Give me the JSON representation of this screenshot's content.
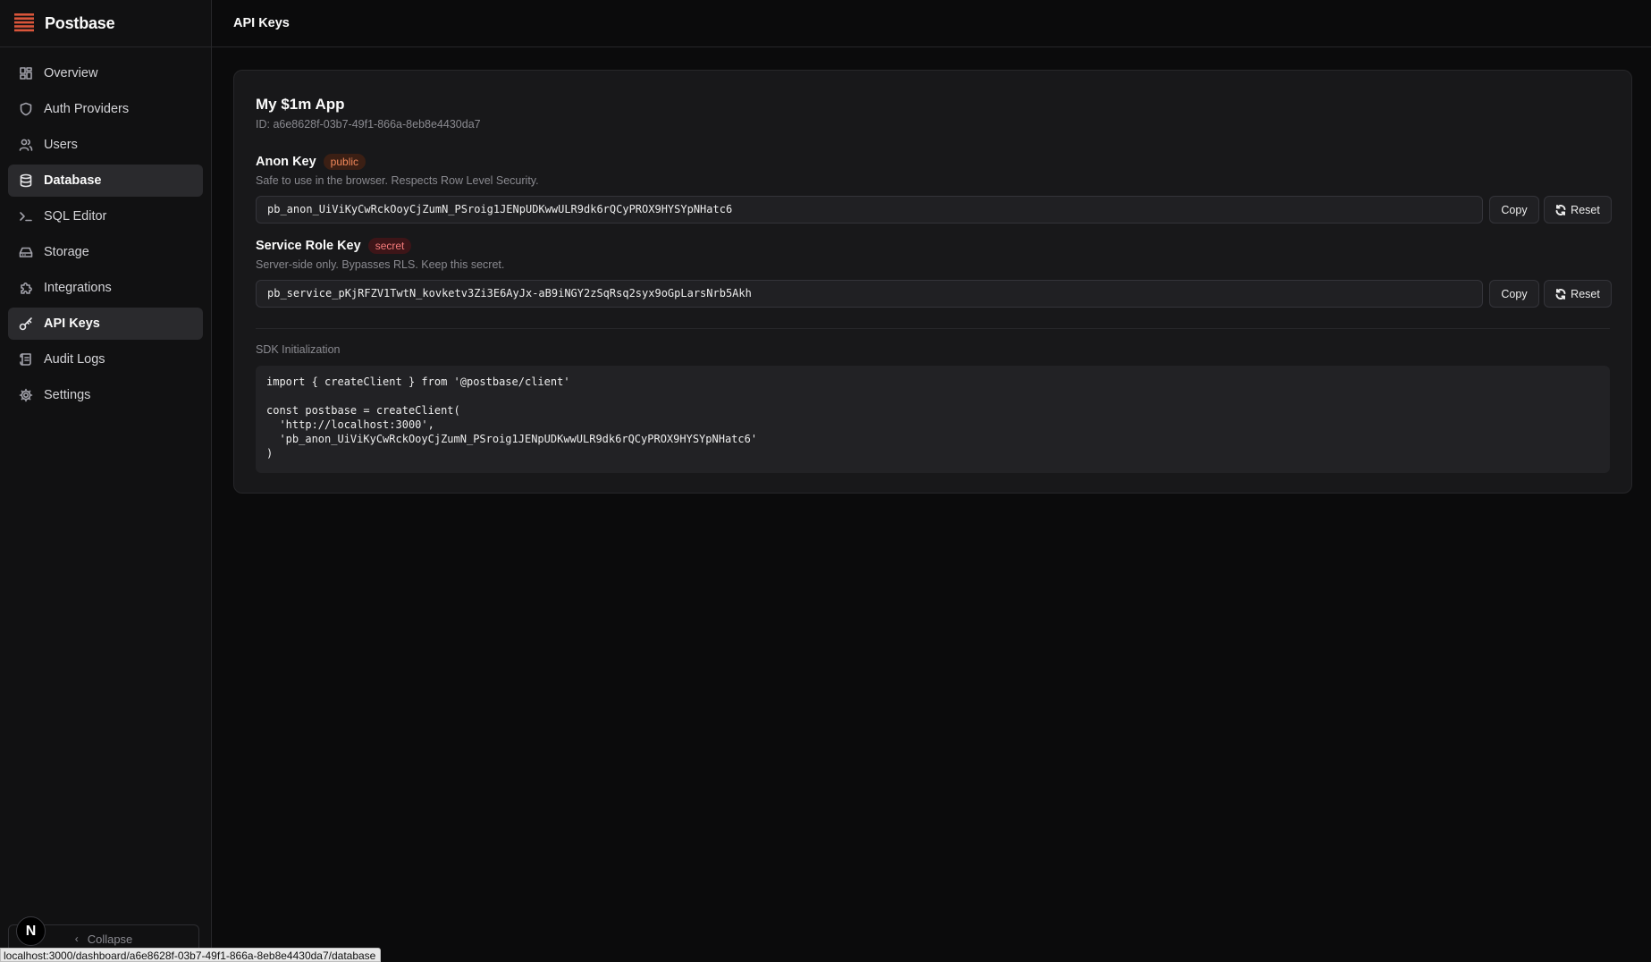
{
  "brand": {
    "name": "Postbase",
    "accent": "#d9553a"
  },
  "sidebar": {
    "items": [
      {
        "label": "Overview",
        "icon": "grid-icon"
      },
      {
        "label": "Auth Providers",
        "icon": "shield-icon"
      },
      {
        "label": "Users",
        "icon": "users-icon"
      },
      {
        "label": "Database",
        "icon": "database-icon",
        "active": true
      },
      {
        "label": "SQL Editor",
        "icon": "terminal-icon"
      },
      {
        "label": "Storage",
        "icon": "hard-drive-icon"
      },
      {
        "label": "Integrations",
        "icon": "puzzle-icon"
      },
      {
        "label": "API Keys",
        "icon": "key-icon",
        "active": true
      },
      {
        "label": "Audit Logs",
        "icon": "scroll-icon"
      },
      {
        "label": "Settings",
        "icon": "gear-icon"
      }
    ],
    "collapse_label": "Collapse",
    "n_badge": "N"
  },
  "header": {
    "title": "API Keys"
  },
  "project": {
    "name": "My $1m App",
    "id_text": "ID: a6e8628f-03b7-49f1-866a-8eb8e4430da7"
  },
  "keys": {
    "anon": {
      "label": "Anon Key",
      "tag": "public",
      "description": "Safe to use in the browser. Respects Row Level Security.",
      "value": "pb_anon_UiViKyCwRckOoyCjZumN_PSroig1JENpUDKwwULR9dk6rQCyPROX9HYSYpNHatc6",
      "copy_label": "Copy",
      "reset_label": "Reset"
    },
    "service": {
      "label": "Service Role Key",
      "tag": "secret",
      "description": "Server-side only. Bypasses RLS. Keep this secret.",
      "value": "pb_service_pKjRFZV1TwtN_kovketv3Zi3E6AyJx-aB9iNGY2zSqRsq2syx9oGpLarsNrb5Akh",
      "copy_label": "Copy",
      "reset_label": "Reset"
    }
  },
  "sdk": {
    "label": "SDK Initialization",
    "code": "import { createClient } from '@postbase/client'\n\nconst postbase = createClient(\n  'http://localhost:3000',\n  'pb_anon_UiViKyCwRckOoyCjZumN_PSroig1JENpUDKwwULR9dk6rQCyPROX9HYSYpNHatc6'\n)"
  },
  "statusbar": {
    "url": "localhost:3000/dashboard/a6e8628f-03b7-49f1-866a-8eb8e4430da7/database"
  }
}
